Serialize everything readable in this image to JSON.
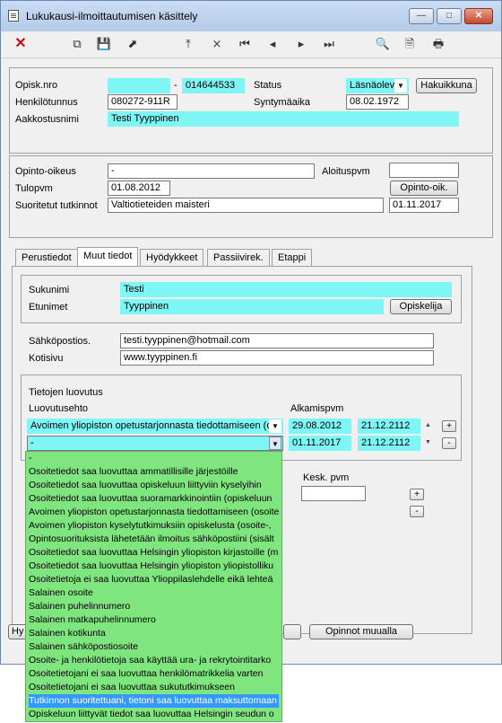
{
  "window": {
    "title": "Lukukausi-ilmoittautumisen käsittely",
    "minimize": "—",
    "maximize": "□",
    "close": "✕"
  },
  "toolbar": {
    "icons": [
      "close-x-icon",
      "copy-icon",
      "save-icon",
      "export-icon",
      "nav-first-icon",
      "nav-delete-icon",
      "nav-begin-icon",
      "nav-prev-icon",
      "nav-next-icon",
      "nav-last-icon",
      "search-icon",
      "documents-icon",
      "print-icon"
    ]
  },
  "header": {
    "opisknro_label": "Opisk.nro",
    "opisknro_value": "",
    "opisknro_dash": "-",
    "opisknro_value2": "014644533",
    "status_label": "Status",
    "status_value": "Läsnäolev",
    "hakuikkuna_button": "Hakuikkuna",
    "henkilotunnus_label": "Henkilötunnus",
    "henkilotunnus_value": "080272-911R",
    "syntymaaika_label": "Syntymäaika",
    "syntymaaika_value": "08.02.1972",
    "aakkostusnimi_label": "Aakkostusnimi",
    "aakkostusnimi_value": "Testi Tyyppinen"
  },
  "study": {
    "opinto_oikeus_label": "Opinto-oikeus",
    "opinto_oikeus_value": "-",
    "aloituspvm_label": "Aloituspvm",
    "aloituspvm_value": "",
    "tulopvm_label": "Tulopvm",
    "tulopvm_value": "01.08.2012",
    "opinto_oik_button": "Opinto-oik.",
    "suoritetut_label": "Suoritetut tutkinnot",
    "suoritetut_value": "Valtiotieteiden maisteri",
    "suoritetut_date": "01.11.2017"
  },
  "tabs": [
    "Perustiedot",
    "Muut tiedot",
    "Hyödykkeet",
    "Passiivirek.",
    "Etappi"
  ],
  "names": {
    "sukunimi_label": "Sukunimi",
    "sukunimi_value": "Testi",
    "etunimet_label": "Etunimet",
    "etunimet_value": "Tyyppinen",
    "opiskelija_button": "Opiskelija"
  },
  "contact": {
    "email_label": "Sähköpostios.",
    "email_value": "testi.tyyppinen@hotmail.com",
    "homepage_label": "Kotisivu",
    "homepage_value": "www.tyyppinen.fi"
  },
  "luovutus": {
    "title": "Tietojen luovutus",
    "col_ehto": "Luovutusehto",
    "col_alkamispvm": "Alkamispvm",
    "row1": {
      "ehto": "Avoimen yliopiston opetustarjonnasta tiedottamiseen (o",
      "alku": "29.08.2012",
      "loppu": "21.12.2112"
    },
    "row2": {
      "ehto": "-",
      "alku": "01.11.2017",
      "loppu": "21.12.2112"
    },
    "plus": "+",
    "minus": "-"
  },
  "lower": {
    "kesk_label": "Kesk. pvm",
    "kesk_value": "",
    "plus": "+",
    "minus": "-",
    "hy_button": "Hy",
    "opinnot_muualla_button": "Opinnot muualla"
  },
  "dropdown": {
    "selected_index": 18,
    "options": [
      "-",
      "Osoitetiedot saa luovuttaa ammatillisille järjestöille",
      "Osoitetiedot saa luovuttaa opiskeluun liittyviin kyselyihin",
      "Osoitetiedot saa luovuttaa suoramarkkinointiin (opiskeluun",
      "Avoimen yliopiston opetustarjonnasta tiedottamiseen (osoite",
      "Avoimen yliopiston kyselytutkimuksiin opiskelusta (osoite-,",
      "Opintosuorituksista lähetetään ilmoitus sähköpostiini (sisält",
      "Osoitetiedot saa luovuttaa Helsingin yliopiston kirjastoille (m",
      "Osoitetiedot saa luovuttaa Helsingin yliopiston yliopistolliku",
      "Osoitetietoja ei saa luovuttaa Ylioppilaslehdelle eikä lehteä",
      "Salainen osoite",
      "Salainen puhelinnumero",
      "Salainen matkapuhelinnumero",
      "Salainen kotikunta",
      "Salainen sähköpostiosoite",
      "Osoite- ja henkilötietoja saa käyttää ura- ja rekrytointitarko",
      "Osoitetietojani ei saa luovuttaa henkilömatrikkelia varten",
      "Osoitetietojani ei saa luovuttaa sukututkimukseen",
      "Tutkinnon suoritettuani, tietoni saa luovuttaa maksuttomaan",
      "Opiskeluun liittyvät tiedot saa luovuttaa Helsingin seudun o"
    ]
  }
}
